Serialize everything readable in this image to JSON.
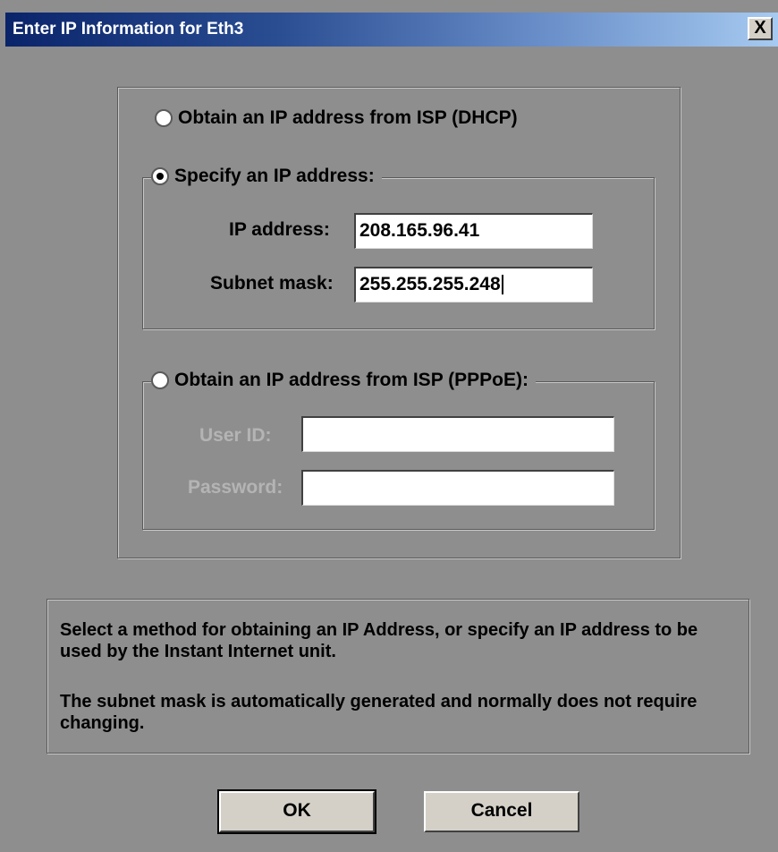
{
  "window": {
    "title": "Enter IP Information for Eth3",
    "close_label": "X"
  },
  "options": {
    "dhcp_label": "Obtain an IP address from ISP (DHCP)",
    "dhcp_selected": false,
    "static_label": "Specify an IP address:",
    "static_selected": true,
    "pppoe_label": "Obtain an IP address from ISP (PPPoE):",
    "pppoe_selected": false
  },
  "static": {
    "ip_label": "IP address:",
    "ip_value": "208.165.96.41",
    "subnet_label": "Subnet mask:",
    "subnet_value": "255.255.255.248"
  },
  "pppoe": {
    "userid_label": "User ID:",
    "userid_value": "",
    "password_label": "Password:",
    "password_value": ""
  },
  "help": {
    "paragraph1": "Select a method for obtaining an IP Address, or specify an IP address to be used by the Instant Internet unit.",
    "paragraph2": "The subnet mask is automatically generated and normally does not require changing."
  },
  "buttons": {
    "ok_label": "OK",
    "cancel_label": "Cancel"
  }
}
